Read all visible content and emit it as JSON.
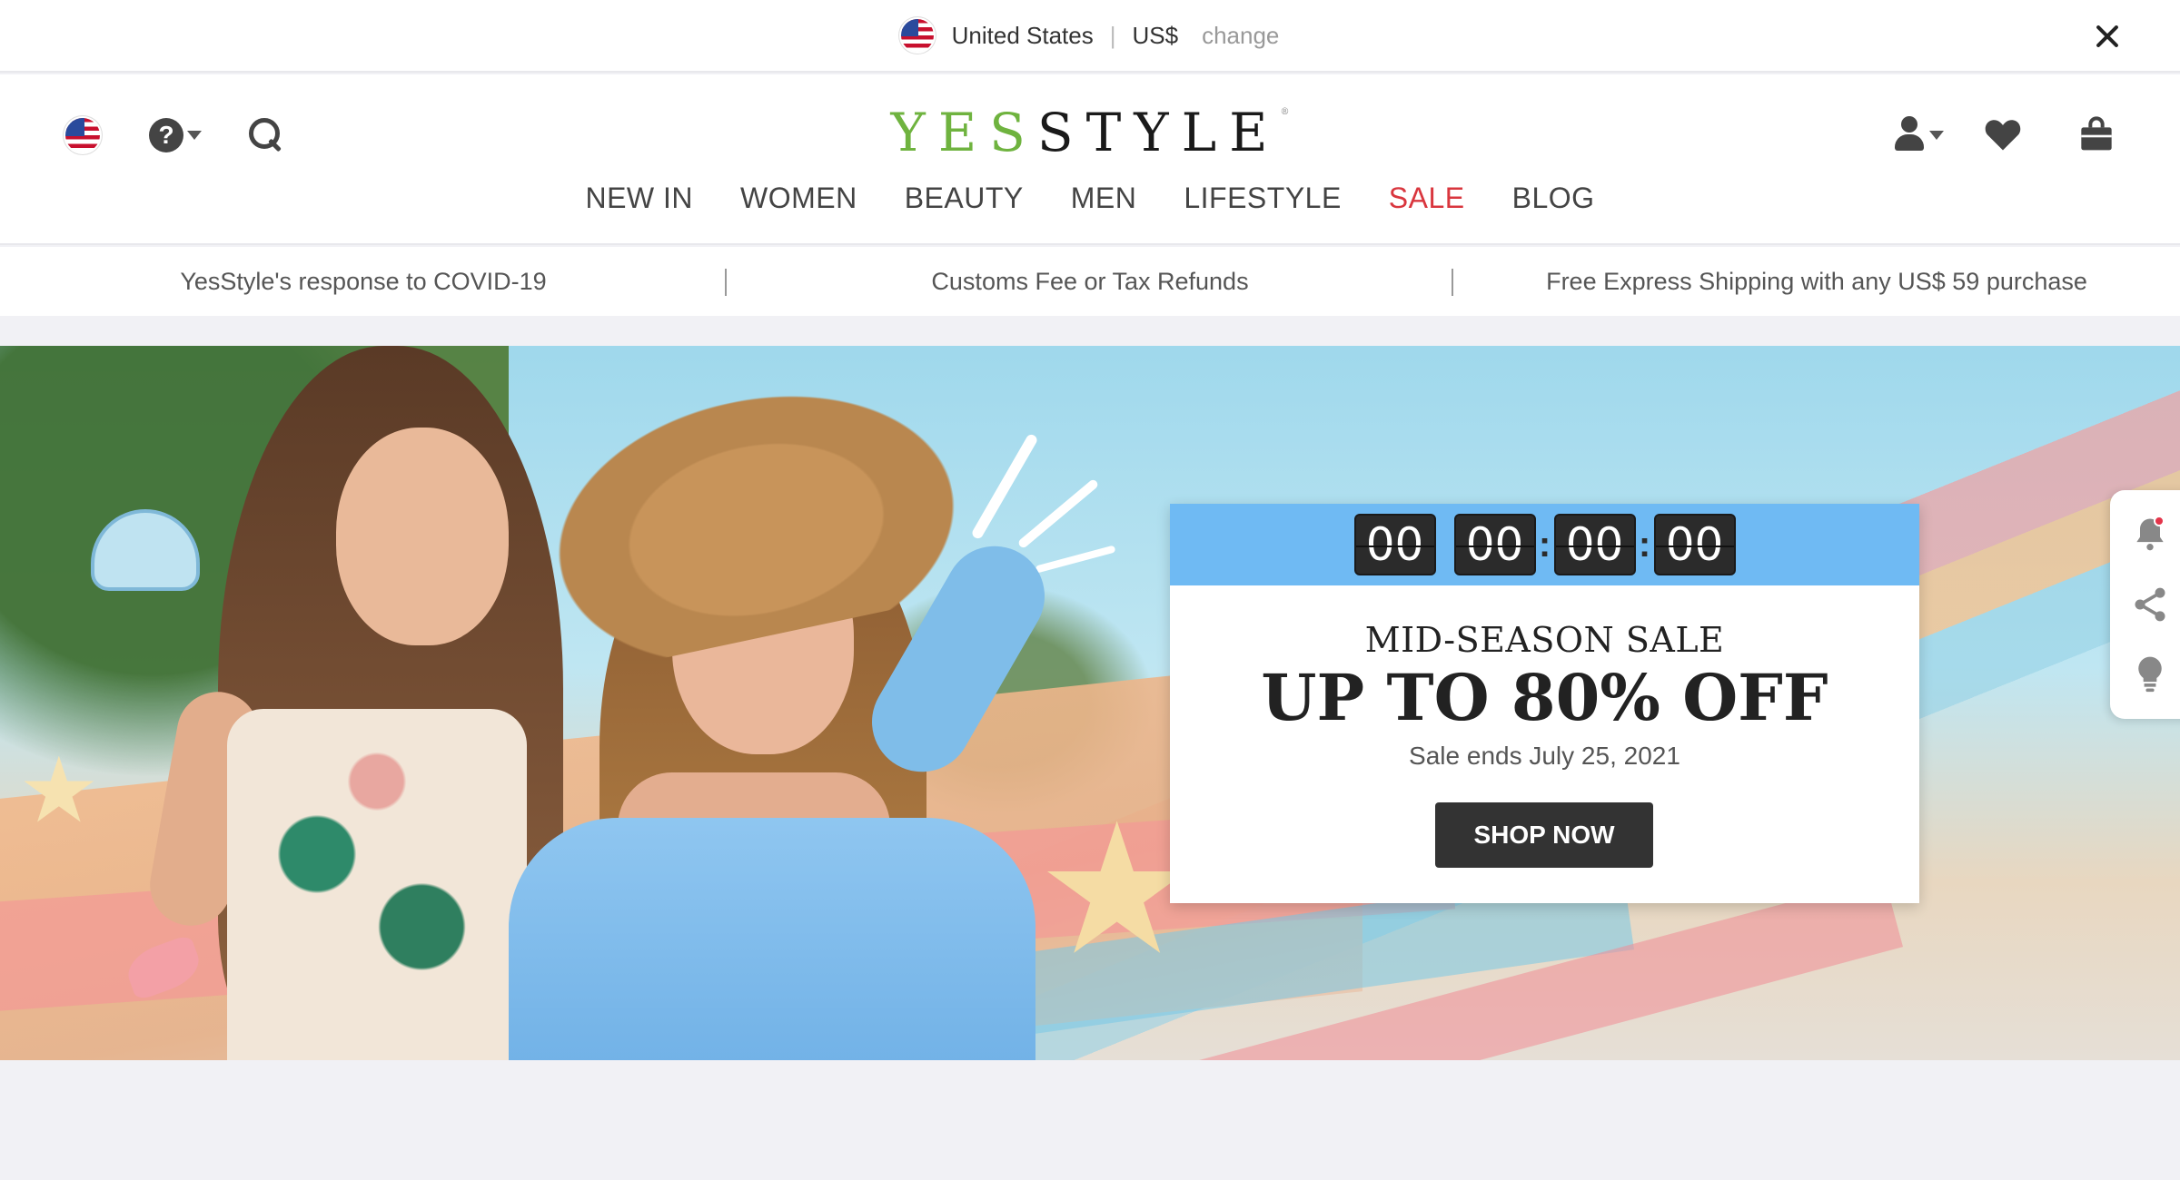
{
  "locale": {
    "country": "United States",
    "separator": "|",
    "currency": "US$",
    "change_label": "change"
  },
  "header": {
    "logo_green": "YES",
    "logo_dark": "STYLE",
    "logo_mark": "®"
  },
  "nav": {
    "items": [
      "NEW IN",
      "WOMEN",
      "BEAUTY",
      "MEN",
      "LIFESTYLE",
      "SALE",
      "BLOG"
    ]
  },
  "info_bar": {
    "items": [
      "YesStyle's response to COVID-19",
      "Customs Fee or Tax Refunds",
      "Free Express Shipping with any US$ 59 purchase"
    ]
  },
  "promo": {
    "timer": {
      "days": "00",
      "hours": "00",
      "minutes": "00",
      "seconds": "00",
      "colon": ":"
    },
    "kicker": "MID-SEASON SALE",
    "headline": "UP TO 80% OFF",
    "ends": "Sale ends July 25, 2021",
    "cta": "SHOP NOW"
  },
  "colors": {
    "brand_green": "#6fb33f",
    "sale_red": "#d9363e",
    "timer_blue": "#6fbaf3",
    "cta_dark": "#333333"
  },
  "icons": {
    "locale_flag": "us-flag-icon",
    "close": "close-icon",
    "help": "help-icon",
    "search": "search-icon",
    "account": "user-icon",
    "wishlist": "heart-icon",
    "cart": "shopping-bag-icon",
    "notifications": "bell-icon",
    "share": "share-icon",
    "tips": "lightbulb-icon"
  }
}
